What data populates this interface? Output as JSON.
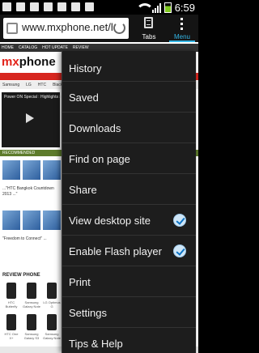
{
  "status_bar": {
    "time": "6:59",
    "notification_icons": [
      "gallery-icon",
      "android-icon",
      "picture-icon",
      "picture-icon",
      "facebook-icon",
      "gmail-icon",
      "email-icon"
    ]
  },
  "browser": {
    "url": "www.mxphone.net/ho...",
    "tabs_label": "Tabs",
    "menu_label": "Menu"
  },
  "webpage": {
    "logo_prefix": "mx",
    "logo_suffix": "phone",
    "nav_items": [
      "HOME",
      "CATALOG",
      "HOT UPDATE",
      "REVIEW"
    ],
    "categories": [
      "Samsung",
      "LG",
      "HTC",
      "BlackBerry"
    ],
    "video_title": "Power ON Special : Highlights smartp...",
    "section_title": "RECOMMENDED",
    "articles": [
      "...\"HTC Bangkok Countdown 2013 ...\"",
      "\"Freedom to Connect\" ..."
    ],
    "review_title": "REVIEW PHONE",
    "phones": [
      "HTC Butterfly",
      "Samsung Galaxy Note",
      "LG Optimus G",
      "HTC One X+",
      "Samsung Galaxy S3",
      "Samsung Galaxy Note"
    ]
  },
  "menu": {
    "items": [
      {
        "label": "History",
        "checked": null
      },
      {
        "label": "Saved",
        "checked": null
      },
      {
        "label": "Downloads",
        "checked": null
      },
      {
        "label": "Find on page",
        "checked": null
      },
      {
        "label": "Share",
        "checked": null
      },
      {
        "label": "View desktop site",
        "checked": true
      },
      {
        "label": "Enable Flash player",
        "checked": true
      },
      {
        "label": "Print",
        "checked": null
      },
      {
        "label": "Settings",
        "checked": null
      },
      {
        "label": "Tips & Help",
        "checked": null
      }
    ]
  },
  "colors": {
    "accent": "#33b5e5",
    "menu_background": "#1d1d1d",
    "brand_red": "#d7261f"
  }
}
